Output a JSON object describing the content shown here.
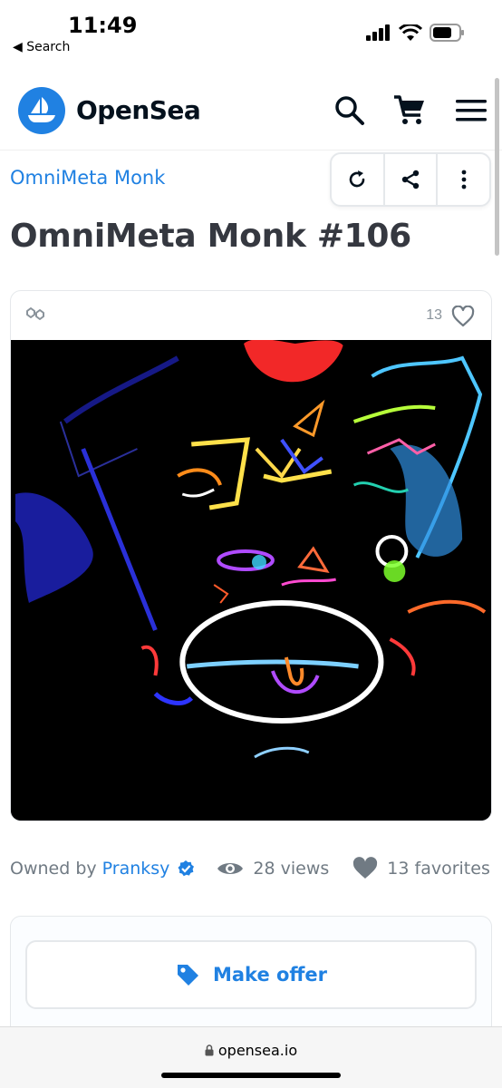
{
  "status_bar": {
    "time": "11:49",
    "back_label": "◀ Search"
  },
  "header": {
    "brand": "OpenSea"
  },
  "asset": {
    "collection": "OmniMeta Monk",
    "title": "OmniMeta Monk #106",
    "favorite_count": "13",
    "owner_prefix": "Owned by",
    "owner": "Pranksy",
    "views": "28 views",
    "favorites": "13 favorites"
  },
  "offer": {
    "button_label": "Make offer"
  },
  "browser": {
    "url": "opensea.io"
  },
  "colors": {
    "accent": "#2081e2",
    "text": "#353840",
    "muted": "#707a83",
    "border": "#e5e8eb"
  },
  "icons": [
    "search-icon",
    "cart-icon",
    "menu-icon",
    "refresh-icon",
    "share-icon",
    "more-icon",
    "chain-icon",
    "heart-icon",
    "verified-icon",
    "eye-icon",
    "tag-icon",
    "lock-icon"
  ]
}
